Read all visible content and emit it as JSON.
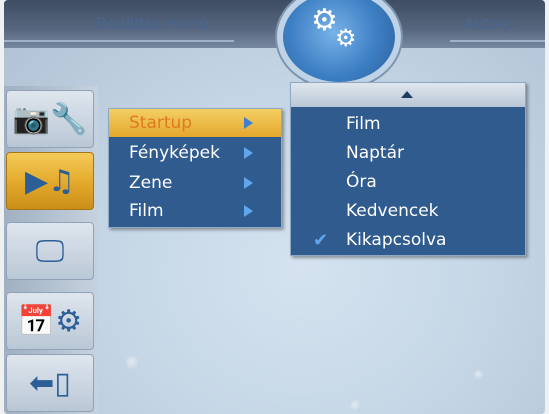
{
  "header": {
    "title_left": "Beállítás menü",
    "title_right": "Auto-p"
  },
  "sidebar": {
    "items": [
      {
        "name": "camera-settings",
        "icon": "camera-wrench-icon"
      },
      {
        "name": "slideshow-music",
        "icon": "projector-music-icon"
      },
      {
        "name": "display",
        "icon": "monitor-icon"
      },
      {
        "name": "calendar-settings",
        "icon": "calendar-gear-icon"
      },
      {
        "name": "exit",
        "icon": "back-door-icon"
      }
    ],
    "selected_index": 1
  },
  "submenu": {
    "items": [
      {
        "label": "Startup",
        "selected": true
      },
      {
        "label": "Fényképek",
        "selected": false
      },
      {
        "label": "Zene",
        "selected": false
      },
      {
        "label": "Film",
        "selected": false
      }
    ]
  },
  "options": {
    "items": [
      {
        "label": "Film",
        "checked": false
      },
      {
        "label": "Naptár",
        "checked": false
      },
      {
        "label": "Óra",
        "checked": false
      },
      {
        "label": "Kedvencek",
        "checked": false
      },
      {
        "label": "Kikapcsolva",
        "checked": true
      }
    ],
    "check_glyph": "✔"
  },
  "colors": {
    "menu_bg": "#2f5b8f",
    "highlight": "#e4a82d",
    "accent_blue": "#5fa6ee"
  }
}
